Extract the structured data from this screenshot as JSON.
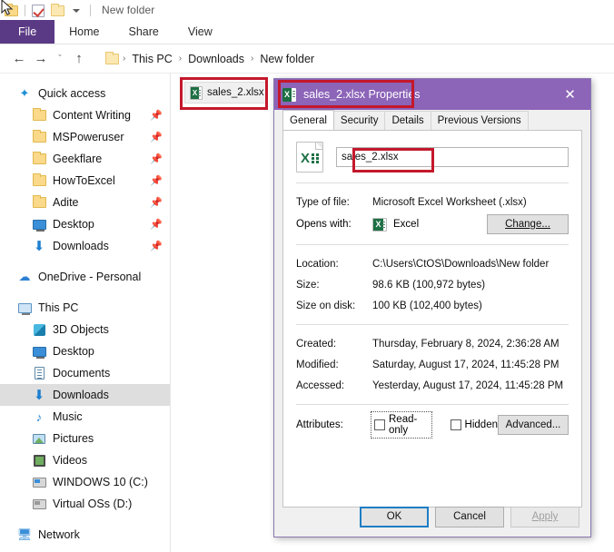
{
  "window": {
    "quick_access_toolbar": {
      "title": "New folder",
      "icons": [
        "folder-icon",
        "properties-checkbox-icon",
        "new-folder-icon",
        "customize-dropdown-icon"
      ]
    },
    "ribbon_tabs": [
      {
        "label": "File",
        "active": true
      },
      {
        "label": "Home",
        "active": false
      },
      {
        "label": "Share",
        "active": false
      },
      {
        "label": "View",
        "active": false
      }
    ],
    "address_bar": {
      "back_icon": "←",
      "forward_icon": "→",
      "recent_icon": "ˇ",
      "up_icon": "↑",
      "breadcrumbs": [
        "This PC",
        "Downloads",
        "New folder"
      ],
      "separator": "›"
    }
  },
  "sidebar": {
    "groups": [
      {
        "header": {
          "label": "Quick access",
          "icon": "star-pin-icon"
        },
        "items": [
          {
            "label": "Content Writing",
            "icon": "folder-icon",
            "pinned": true
          },
          {
            "label": "MSPoweruser",
            "icon": "folder-icon",
            "pinned": true
          },
          {
            "label": "Geekflare",
            "icon": "folder-icon",
            "pinned": true
          },
          {
            "label": "HowToExcel",
            "icon": "folder-icon",
            "pinned": true
          },
          {
            "label": "Adite",
            "icon": "folder-icon",
            "pinned": true
          },
          {
            "label": "Desktop",
            "icon": "desktop-icon",
            "pinned": true
          },
          {
            "label": "Downloads",
            "icon": "downloads-icon",
            "pinned": true
          }
        ]
      },
      {
        "header": {
          "label": "OneDrive - Personal",
          "icon": "onedrive-cloud-icon"
        },
        "items": []
      },
      {
        "header": {
          "label": "This PC",
          "icon": "this-pc-icon"
        },
        "items": [
          {
            "label": "3D Objects",
            "icon": "3d-objects-icon",
            "selected": false
          },
          {
            "label": "Desktop",
            "icon": "desktop-icon",
            "selected": false
          },
          {
            "label": "Documents",
            "icon": "documents-icon",
            "selected": false
          },
          {
            "label": "Downloads",
            "icon": "downloads-icon",
            "selected": true
          },
          {
            "label": "Music",
            "icon": "music-icon",
            "selected": false
          },
          {
            "label": "Pictures",
            "icon": "pictures-icon",
            "selected": false
          },
          {
            "label": "Videos",
            "icon": "videos-icon",
            "selected": false
          },
          {
            "label": "WINDOWS 10 (C:)",
            "icon": "drive-icon",
            "selected": false
          },
          {
            "label": "Virtual OSs (D:)",
            "icon": "drive-icon",
            "selected": false
          }
        ]
      },
      {
        "header": {
          "label": "Network",
          "icon": "network-icon"
        },
        "items": []
      }
    ],
    "pin_glyph": "📌"
  },
  "file_pane": {
    "selected_file": {
      "label": "sales_2.xlsx",
      "icon": "excel-file-icon"
    }
  },
  "dialog": {
    "title": "sales_2.xlsx Properties",
    "title_icon": "excel-file-icon",
    "close_icon": "✕",
    "tabs": [
      {
        "label": "General",
        "active": true
      },
      {
        "label": "Security",
        "active": false
      },
      {
        "label": "Details",
        "active": false
      },
      {
        "label": "Previous Versions",
        "active": false
      }
    ],
    "general": {
      "file_name_value": "sales_2.xlsx",
      "type_of_file_label": "Type of file:",
      "type_of_file_value": "Microsoft Excel Worksheet (.xlsx)",
      "opens_with_label": "Opens with:",
      "opens_with_value": "Excel",
      "change_button": "Change...",
      "location_label": "Location:",
      "location_value": "C:\\Users\\CtOS\\Downloads\\New folder",
      "size_label": "Size:",
      "size_value": "98.6 KB (100,972 bytes)",
      "size_on_disk_label": "Size on disk:",
      "size_on_disk_value": "100 KB (102,400 bytes)",
      "created_label": "Created:",
      "created_value": "Thursday, February 8, 2024, 2:36:28 AM",
      "modified_label": "Modified:",
      "modified_value": "Saturday, August 17, 2024, 11:45:28 PM",
      "accessed_label": "Accessed:",
      "accessed_value": "Yesterday, August 17, 2024, 11:45:28 PM",
      "attributes_label": "Attributes:",
      "read_only_label": "Read-only",
      "read_only_checked": false,
      "hidden_label": "Hidden",
      "hidden_checked": false,
      "advanced_button": "Advanced..."
    },
    "footer": {
      "ok": "OK",
      "cancel": "Cancel",
      "apply": "Apply",
      "apply_disabled": true
    }
  },
  "annotations": {
    "highlight_color": "#c4182c",
    "boxes": [
      "file-item-highlight",
      "dialog-title-highlight",
      "file-name-field-highlight"
    ]
  },
  "colors": {
    "ribbon_file_tab": "#5b3a85",
    "dialog_title_bar": "#8c64b8",
    "selection": "#dedede",
    "focus_blue": "#1d7dc4"
  }
}
